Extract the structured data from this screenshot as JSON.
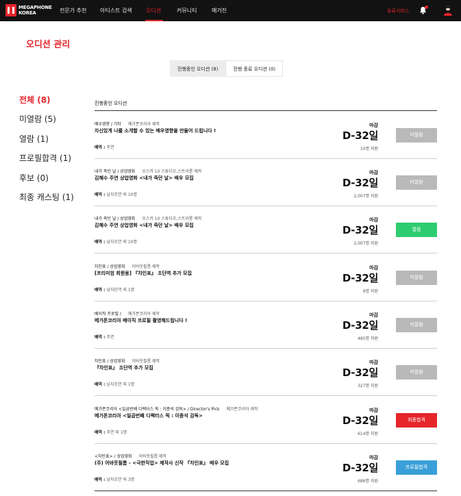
{
  "brand": {
    "line1": "MEGAPHONE",
    "line2": "KOREA"
  },
  "nav": [
    {
      "label": "전문가 추천",
      "active": false
    },
    {
      "label": "아티스트 검색",
      "active": false
    },
    {
      "label": "오디션",
      "active": true
    },
    {
      "label": "커뮤니티",
      "active": false
    },
    {
      "label": "매거진",
      "active": false
    }
  ],
  "header_right": {
    "paid_service": "유료서비스"
  },
  "page_title": "오디션 관리",
  "tabs": [
    {
      "label": "진행중인 오디션 (8)",
      "active": true
    },
    {
      "label": "진행 종료 오디션 (0)",
      "active": false
    }
  ],
  "filters": [
    {
      "label": "전체 (8)",
      "active": true
    },
    {
      "label": "미열람 (5)",
      "active": false
    },
    {
      "label": "열람 (1)",
      "active": false
    },
    {
      "label": "프로필합격 (1)",
      "active": false
    },
    {
      "label": "후보 (0)",
      "active": false
    },
    {
      "label": "최종 캐스팅 (1)",
      "active": false
    }
  ],
  "list_title": "진행중인 오디션",
  "deadline_label": "마감",
  "role_label": "배역 :",
  "colors": {
    "accent": "#e5252a",
    "unread": "#b9b9b9",
    "opened": "#2ecc71",
    "final": "#e5252a",
    "profile_pass": "#3a9fd8"
  },
  "auditions": [
    {
      "category": "배우영향 / 기타",
      "company": "메가폰코리아 제작",
      "title": "자신있게 나를 소개할 수 있는 배우영향을 만들어 드립니다 !",
      "role": "주연",
      "dday": "D-32일",
      "applicants": "10명 지원",
      "status": "미열람",
      "status_type": "unread"
    },
    {
      "category": "내가 죽던 날 / 상업영화",
      "company": "오스카 10 스튜디오,스트리롱 제작",
      "title": "김혜수 주연 상업영화 <내가 죽던 날> 배우 모집",
      "role": "남자조연 외 10명",
      "dday": "D-32일",
      "applicants": "2,007명 지원",
      "status": "미열람",
      "status_type": "unread"
    },
    {
      "category": "내가 죽던 날 / 상업영화",
      "company": "오스카 10 스튜디오,스트리롱 제작",
      "title": "김혜수 주연 상업영화 <내가 죽던 날> 배우 모집",
      "role": "남자조연 외 10명",
      "dday": "D-32일",
      "applicants": "2,007명 지원",
      "status": "열람",
      "status_type": "opened"
    },
    {
      "category": "차인표 / 상업영화",
      "company": "이바웃필름 제작",
      "title": "[프리미엄 회원용] 『차인표』 조단역 추가 모집",
      "role": "남자단역 외 1명",
      "dday": "D-32일",
      "applicants": "9명 지원",
      "status": "미열람",
      "status_type": "unread"
    },
    {
      "category": "베이직 프로필 /",
      "company": "메가폰코리아 제작",
      "title": "메가폰코리아 베이직 프로필 촬영해드립니다 !",
      "role": "주연",
      "dday": "D-32일",
      "applicants": "485명 지원",
      "status": "미열람",
      "status_type": "unread"
    },
    {
      "category": "차인표 / 상업영화",
      "company": "이바웃필름 제작",
      "title": "『차인표』 조단역 추가 모집",
      "role": "남자조연 외 1명",
      "dday": "D-32일",
      "applicants": "327명 지원",
      "status": "미열람",
      "status_type": "unread"
    },
    {
      "category": "메가폰코리아 <일곱번째 디렉터스 픽 : 이종석 감독> / Director's Pick",
      "company": "메가폰코리아 제작",
      "title": "메가폰코리아 <일곱번째 디렉터스 픽 : 이종석 감독>",
      "role": "주연 외 1명",
      "dday": "D-32일",
      "applicants": "614명 지원",
      "status": "최종합격",
      "status_type": "final"
    },
    {
      "category": "<차인표> / 상업영화",
      "company": "이바웃필름 제작",
      "title": "(주) 어바웃필름 - <극한직업> 제작사 신작 『차인표』 배우 모집",
      "role": "남자조연 외 3명",
      "dday": "D-32일",
      "applicants": "686명 지원",
      "status": "프로필합격",
      "status_type": "passed"
    }
  ]
}
